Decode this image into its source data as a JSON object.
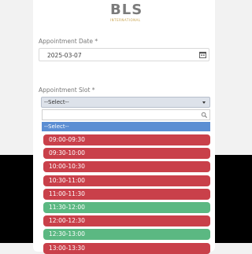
{
  "logo": {
    "main": "BLS",
    "sub": "INTERNATIONAL"
  },
  "appointment_date": {
    "label": "Appointment Date",
    "required_mark": "*",
    "value": "2025-03-07"
  },
  "appointment_slot": {
    "label": "Appointment Slot",
    "required_mark": "*",
    "selected": "--Select--",
    "highlighted_option": "--Select--",
    "options": [
      {
        "time": "09:00-09:30",
        "status": "unavailable"
      },
      {
        "time": "09:30-10:00",
        "status": "unavailable"
      },
      {
        "time": "10:00-10:30",
        "status": "unavailable"
      },
      {
        "time": "10:30-11:00",
        "status": "unavailable"
      },
      {
        "time": "11:00-11:30",
        "status": "unavailable"
      },
      {
        "time": "11:30-12:00",
        "status": "available"
      },
      {
        "time": "12:00-12:30",
        "status": "unavailable"
      },
      {
        "time": "12:30-13:00",
        "status": "available"
      },
      {
        "time": "13:00-13:30",
        "status": "unavailable"
      }
    ]
  },
  "colors": {
    "available": "#5bb882",
    "unavailable": "#c9404a",
    "highlight": "#5b8ed3",
    "brand_gold": "#c8a14b"
  }
}
